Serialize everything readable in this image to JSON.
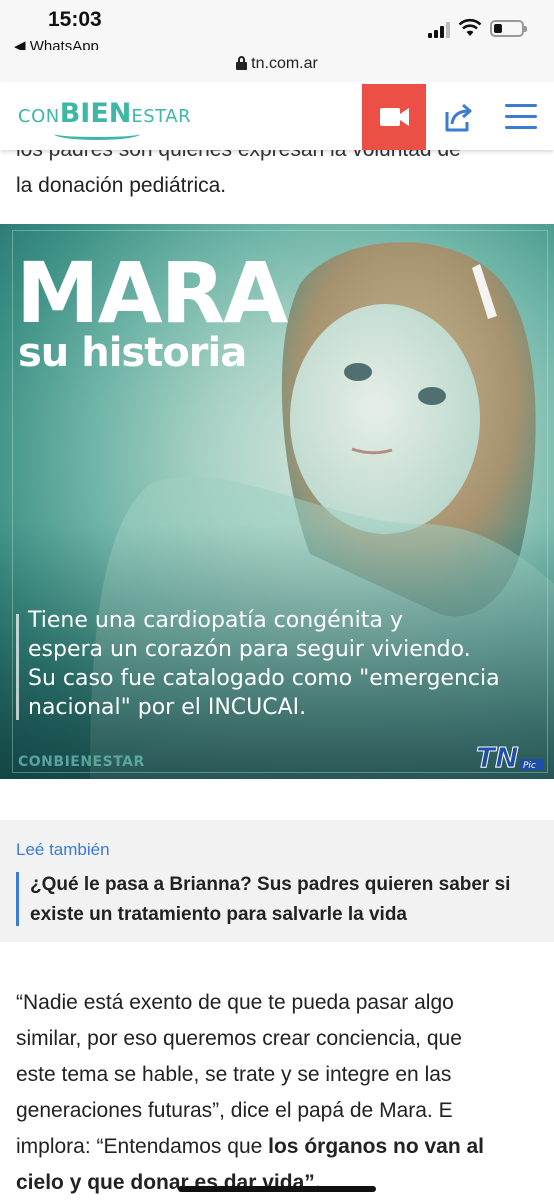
{
  "status_bar": {
    "time": "15:03",
    "back_app": "◀ WhatsApp"
  },
  "browser": {
    "url": "tn.com.ar"
  },
  "header": {
    "logo_prefix": "CON",
    "logo_main": "BIEN",
    "logo_suffix": "ESTAR",
    "accent_color": "#3fb7a6",
    "video_color": "#ec4f45",
    "icon_color": "#3a7bd5"
  },
  "article": {
    "partial_line": "los padres son quienes expresan la voluntad de",
    "lead_line": "la donación pediátrica.",
    "hero": {
      "title": "MARA",
      "subtitle": "su historia",
      "caption_lines": [
        "Tiene una cardiopatía congénita y",
        "espera un corazón para seguir viviendo.",
        "Su caso fue catalogado como \"emergencia",
        "nacional\" por el INCUCAI."
      ],
      "brand": "CONBIENESTAR",
      "tn_logo": "TN",
      "tn_badge": "Pic"
    },
    "related": {
      "label": "Leé también",
      "title": "¿Qué le pasa a Brianna? Sus padres quieren saber si existe un tratamiento para salvarle la vida"
    },
    "quote": {
      "lines": [
        "“Nadie está exento de que te pueda pasar algo",
        "similar, por eso queremos crear conciencia, que",
        "este tema se hable, se trate y se integre en las",
        "generaciones futuras”, dice el papá de Mara. E"
      ],
      "last_line_prefix": "implora: “Entendamos que ",
      "last_line_bold": "los órganos no van al",
      "cut_line": "cielo y que donar es dar vida”."
    }
  }
}
